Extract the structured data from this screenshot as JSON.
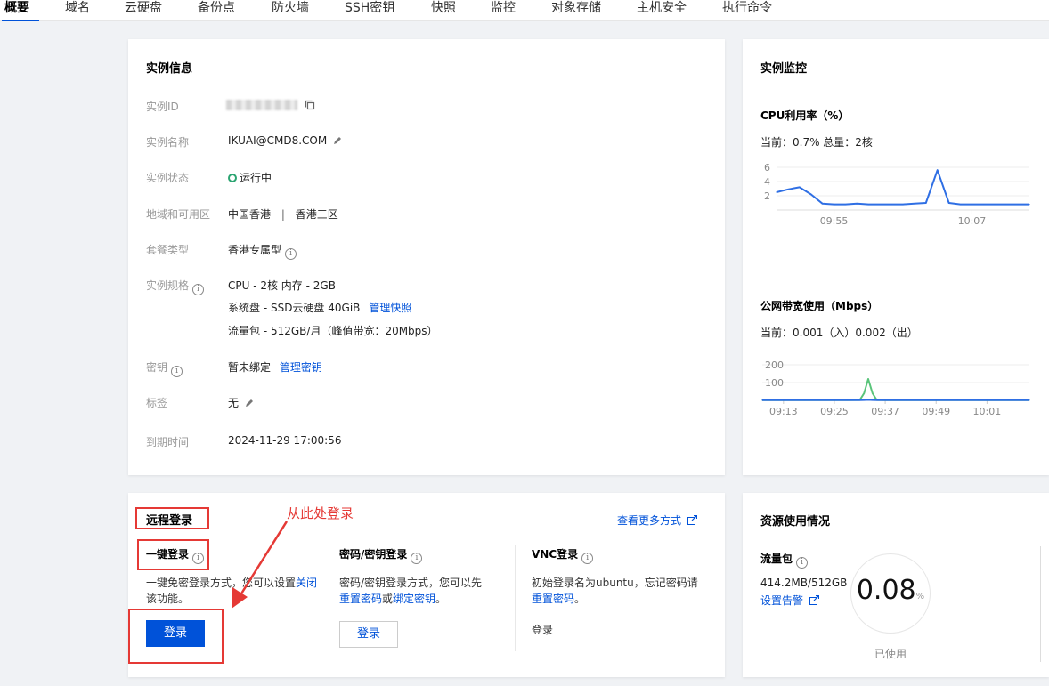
{
  "tabs": [
    "概要",
    "域名",
    "云硬盘",
    "备份点",
    "防火墙",
    "SSH密钥",
    "快照",
    "监控",
    "对象存储",
    "主机安全",
    "执行命令"
  ],
  "instance_info": {
    "title": "实例信息",
    "id_label": "实例ID",
    "name_label": "实例名称",
    "name_value": "IKUAI@CMD8.COM",
    "status_label": "实例状态",
    "status_value": "运行中",
    "region_label": "地域和可用区",
    "region_value": "中国香港",
    "region_sep": "|",
    "zone_value": "香港三区",
    "plan_label": "套餐类型",
    "plan_value": "香港专属型",
    "spec_label": "实例规格",
    "spec_cpu": "CPU - 2核 内存 - 2GB",
    "spec_disk": "系统盘 - SSD云硬盘 40GiB",
    "spec_disk_link": "管理快照",
    "spec_traffic": "流量包 - 512GB/月（峰值带宽：20Mbps）",
    "key_label": "密钥",
    "key_value": "暂未绑定",
    "key_link": "管理密钥",
    "tag_label": "标签",
    "tag_value": "无",
    "expire_label": "到期时间",
    "expire_value": "2024-11-29 17:00:56"
  },
  "monitor": {
    "title": "实例监控",
    "cpu_title": "CPU利用率（%）",
    "cpu_current": "当前：0.7% 总量：2核",
    "bw_title": "公网带宽使用（Mbps）",
    "bw_current": "当前：0.001（入）0.002（出）"
  },
  "chart_data": [
    {
      "type": "line",
      "title": "CPU利用率（%）",
      "y_ticks": [
        2,
        4,
        6
      ],
      "x_ticks": [
        "09:55",
        "10:07"
      ],
      "ylim": [
        0,
        7
      ],
      "color": "#2f6fe4",
      "x": [
        "09:50",
        "09:51",
        "09:52",
        "09:53",
        "09:54",
        "09:55",
        "09:56",
        "09:57",
        "09:58",
        "09:59",
        "10:00",
        "10:01",
        "10:02",
        "10:03",
        "10:04",
        "10:05",
        "10:06",
        "10:07",
        "10:08",
        "10:09",
        "10:10",
        "10:11",
        "10:12"
      ],
      "series": [
        {
          "values": [
            2.5,
            2.9,
            3.2,
            2.2,
            0.9,
            0.8,
            0.8,
            0.9,
            0.8,
            0.8,
            0.8,
            0.8,
            0.9,
            1.0,
            5.6,
            1.0,
            0.8,
            0.8,
            0.8,
            0.8,
            0.8,
            0.8,
            0.8
          ]
        }
      ]
    },
    {
      "type": "line",
      "title": "公网带宽使用（Mbps）",
      "y_ticks": [
        100,
        200
      ],
      "x_ticks": [
        "09:13",
        "09:25",
        "09:37",
        "09:49",
        "10:01"
      ],
      "ylim": [
        0,
        250
      ],
      "x": [
        "09:08",
        "09:13",
        "09:18",
        "09:23",
        "09:25",
        "09:28",
        "09:31",
        "09:32",
        "09:33",
        "09:34",
        "09:35",
        "09:37",
        "09:42",
        "09:47",
        "09:49",
        "09:54",
        "09:59",
        "10:01",
        "10:06",
        "10:11"
      ],
      "series": [
        {
          "color": "#59c47a",
          "values": [
            1,
            1,
            1,
            1,
            1,
            1,
            2,
            40,
            120,
            40,
            2,
            1,
            1,
            1,
            1,
            1,
            1,
            1,
            1,
            1
          ]
        },
        {
          "color": "#2f6fe4",
          "values": [
            1,
            1,
            1,
            1,
            1,
            1,
            1,
            2,
            3,
            2,
            1,
            1,
            1,
            1,
            1,
            1,
            1,
            1,
            1,
            1
          ]
        }
      ]
    }
  ],
  "remote": {
    "title": "远程登录",
    "more_link": "查看更多方式",
    "annotation": "从此处登录",
    "one_click_title": "一键登录",
    "one_click_desc1": "一键免密登录方式，",
    "one_click_desc2": "您可以设置",
    "one_click_desc_link": "关闭",
    "one_click_desc3": "该功能。",
    "login_button": "登录",
    "pwd_title": "密码/密钥登录",
    "pwd_desc": "密码/密钥登录方式，您可以先",
    "pwd_link1": "重置密码",
    "pwd_or": "或",
    "pwd_link2": "绑定密钥",
    "pwd_end": "。",
    "pwd_button": "登录",
    "vnc_title": "VNC登录",
    "vnc_desc": "初始登录名为ubuntu，忘记密码请",
    "vnc_link": "重置密码",
    "vnc_end": "。",
    "vnc_login": "登录"
  },
  "resource": {
    "title": "资源使用情况",
    "traffic_title": "流量包",
    "traffic_value": "414.2MB/512GB",
    "alert_link": "设置告警",
    "percent": "0.08",
    "percent_unit": "%",
    "used_label": "已使用"
  },
  "colors": {
    "accent": "#0052d9",
    "running": "#2ba471",
    "annotation": "#e53935"
  }
}
